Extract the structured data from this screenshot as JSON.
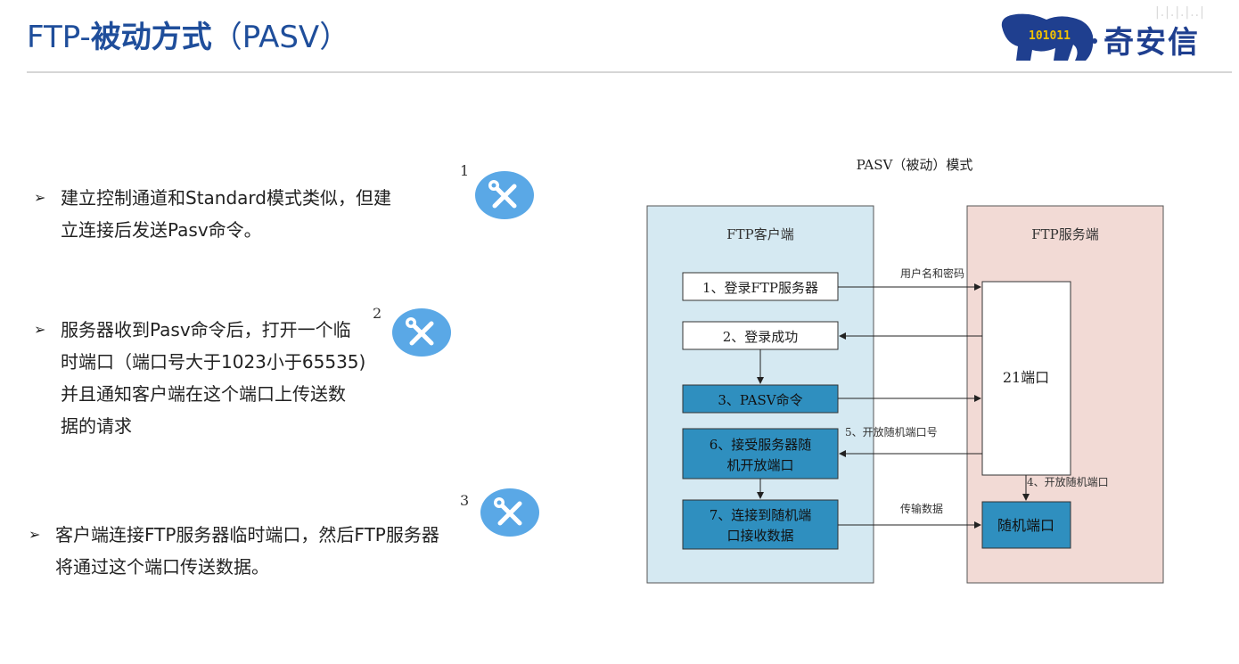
{
  "header": {
    "title_prefix": "FTP-",
    "title_main": "被动方式",
    "title_suffix": "（PASV）",
    "logo_text": "奇安信",
    "logo_digits": [
      "1",
      "0",
      "1",
      "0",
      "1",
      "1"
    ],
    "deco_text": "|.|.|.|..|",
    "title_color": "#1f4e9b"
  },
  "bullets": [
    {
      "num": "1",
      "lines": [
        "建立控制通道和Standard模式类似，但建",
        "立连接后发送Pasv命令。"
      ]
    },
    {
      "num": "2",
      "lines": [
        "服务器收到Pasv命令后，打开一个临",
        "时端口（端口号大于1023小于65535)",
        "并且通知客户端在这个端口上传送数",
        "据的请求"
      ]
    },
    {
      "num": "3",
      "lines": [
        "客户端连接FTP服务器临时端口，然后FTP服务器",
        "将通过这个端口传送数据。"
      ]
    }
  ],
  "bullet_mark": "➢",
  "icons": {
    "tool": "wrench-screwdriver-icon",
    "color": "#5aa8e6"
  },
  "diagram": {
    "title": "PASV（被动）模式",
    "client_label": "FTP客户端",
    "server_label": "FTP服务端",
    "client_color": "#d5e9f2",
    "server_color": "#f2dad5",
    "box_color": "#2f8fbf",
    "steps": {
      "s1": "1、登录FTP服务器",
      "s2": "2、登录成功",
      "s3": "3、PASV命令",
      "s6a": "6、接受服务器随",
      "s6b": "机开放端口",
      "s7a": "7、连接到随机端",
      "s7b": "口接收数据"
    },
    "port21": "21端口",
    "random_port": "随机端口",
    "arrows": {
      "user_pass": "用户名和密码",
      "open_random_num": "5、开放随机端口号",
      "open_random": "4、开放随机端口",
      "transfer": "传输数据"
    }
  }
}
